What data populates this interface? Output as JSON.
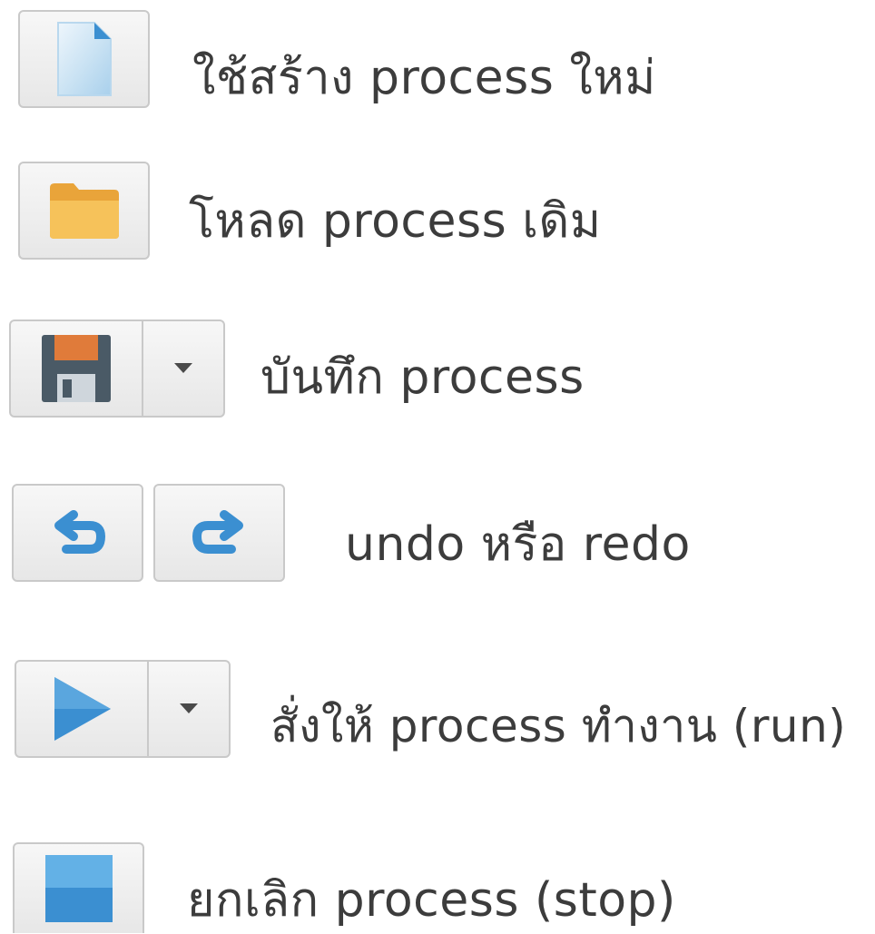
{
  "toolbar_legend": {
    "new": {
      "icon": "new-file-icon",
      "label": "ใช้สร้าง process ใหม่"
    },
    "open": {
      "icon": "folder-icon",
      "label": "โหลด process เดิม"
    },
    "save": {
      "icon": "floppy-disk-icon",
      "dropdown_icon": "dropdown-arrow-icon",
      "label": "บันทึก process"
    },
    "undo_redo": {
      "undo_icon": "undo-icon",
      "redo_icon": "redo-icon",
      "label": "undo หรือ redo"
    },
    "run": {
      "icon": "play-icon",
      "dropdown_icon": "dropdown-arrow-icon",
      "label": "สั่งให้ process ทำงาน (run)"
    },
    "stop": {
      "icon": "stop-icon",
      "label": "ยกเลิก process (stop)"
    }
  },
  "colors": {
    "accent_blue": "#3b8fd1",
    "folder_orange": "#f3b445",
    "floppy_dark": "#4a5a66",
    "floppy_orange": "#e07b3a",
    "button_border": "#c9c9c9",
    "text": "#3c3c3c"
  }
}
